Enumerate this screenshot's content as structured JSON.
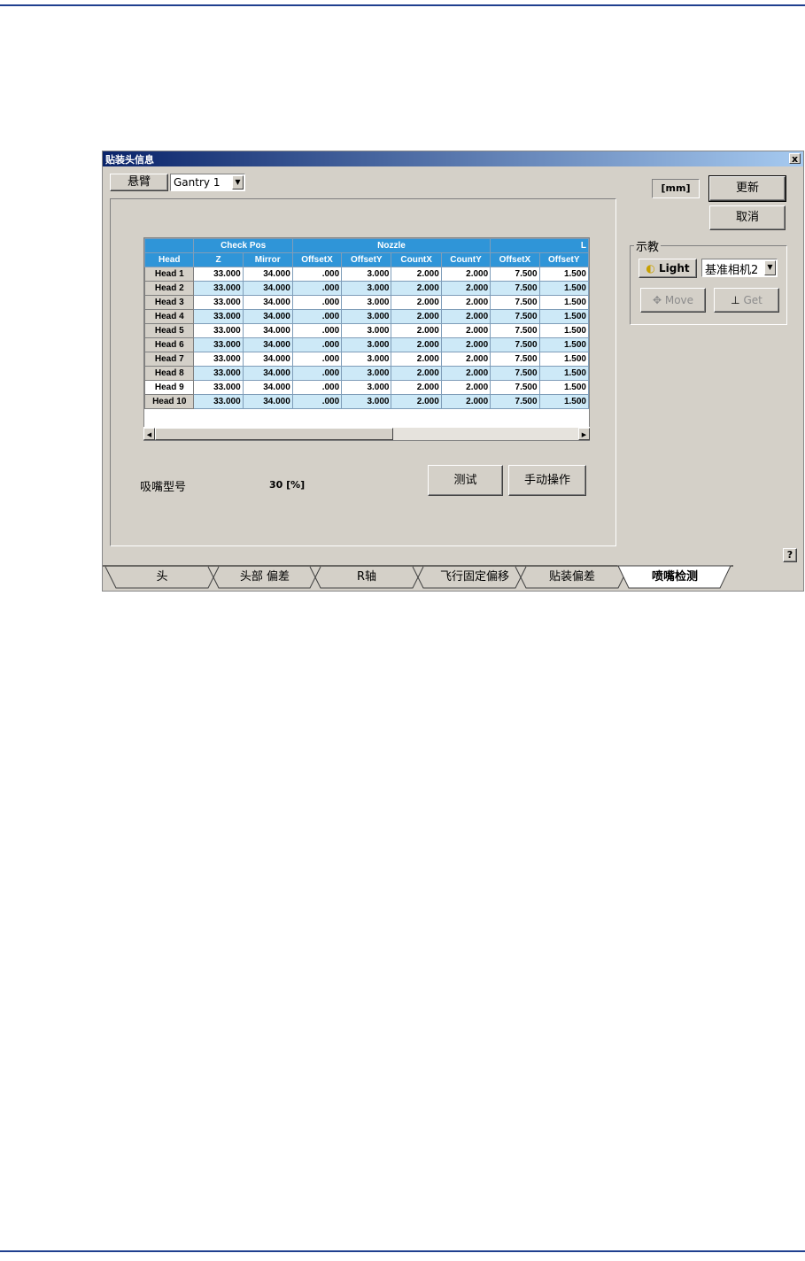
{
  "dialog": {
    "title": "贴装头信息",
    "close_label": "x"
  },
  "gantry": {
    "label": "悬臂",
    "selected": "Gantry 1"
  },
  "unit": {
    "label": "[mm]"
  },
  "buttons": {
    "update": "更新",
    "cancel": "取消",
    "test": "测试",
    "manual": "手动操作",
    "help": "?"
  },
  "teach": {
    "title": "示教",
    "light": "Light",
    "camera": "基准相机2",
    "move": "Move",
    "get": "Get"
  },
  "grid": {
    "group_headers": [
      "",
      "Check Pos",
      "Nozzle",
      "L"
    ],
    "columns": [
      "Head",
      "Z",
      "Mirror",
      "OffsetX",
      "OffsetY",
      "CountX",
      "CountY",
      "OffsetX",
      "OffsetY"
    ],
    "rows": [
      [
        "Head 1",
        "33.000",
        "34.000",
        ".000",
        "3.000",
        "2.000",
        "2.000",
        "7.500",
        "1.500"
      ],
      [
        "Head 2",
        "33.000",
        "34.000",
        ".000",
        "3.000",
        "2.000",
        "2.000",
        "7.500",
        "1.500"
      ],
      [
        "Head 3",
        "33.000",
        "34.000",
        ".000",
        "3.000",
        "2.000",
        "2.000",
        "7.500",
        "1.500"
      ],
      [
        "Head 4",
        "33.000",
        "34.000",
        ".000",
        "3.000",
        "2.000",
        "2.000",
        "7.500",
        "1.500"
      ],
      [
        "Head 5",
        "33.000",
        "34.000",
        ".000",
        "3.000",
        "2.000",
        "2.000",
        "7.500",
        "1.500"
      ],
      [
        "Head 6",
        "33.000",
        "34.000",
        ".000",
        "3.000",
        "2.000",
        "2.000",
        "7.500",
        "1.500"
      ],
      [
        "Head 7",
        "33.000",
        "34.000",
        ".000",
        "3.000",
        "2.000",
        "2.000",
        "7.500",
        "1.500"
      ],
      [
        "Head 8",
        "33.000",
        "34.000",
        ".000",
        "3.000",
        "2.000",
        "2.000",
        "7.500",
        "1.500"
      ],
      [
        "Head 9",
        "33.000",
        "34.000",
        ".000",
        "3.000",
        "2.000",
        "2.000",
        "7.500",
        "1.500"
      ],
      [
        "Head 10",
        "33.000",
        "34.000",
        ".000",
        "3.000",
        "2.000",
        "2.000",
        "7.500",
        "1.500"
      ]
    ]
  },
  "nozzle_type": {
    "label": "吸嘴型号",
    "value": "30 [%]"
  },
  "tabs": [
    {
      "label": "头"
    },
    {
      "label": "头部 偏差"
    },
    {
      "label": "R轴"
    },
    {
      "label": "飞行固定偏移"
    },
    {
      "label": "贴装偏差"
    },
    {
      "label": "喷嘴检测"
    }
  ],
  "colors": {
    "grid_header": "#2f95d8",
    "row_alt": "#cde9f7",
    "page_rule": "#1f3f8f"
  }
}
